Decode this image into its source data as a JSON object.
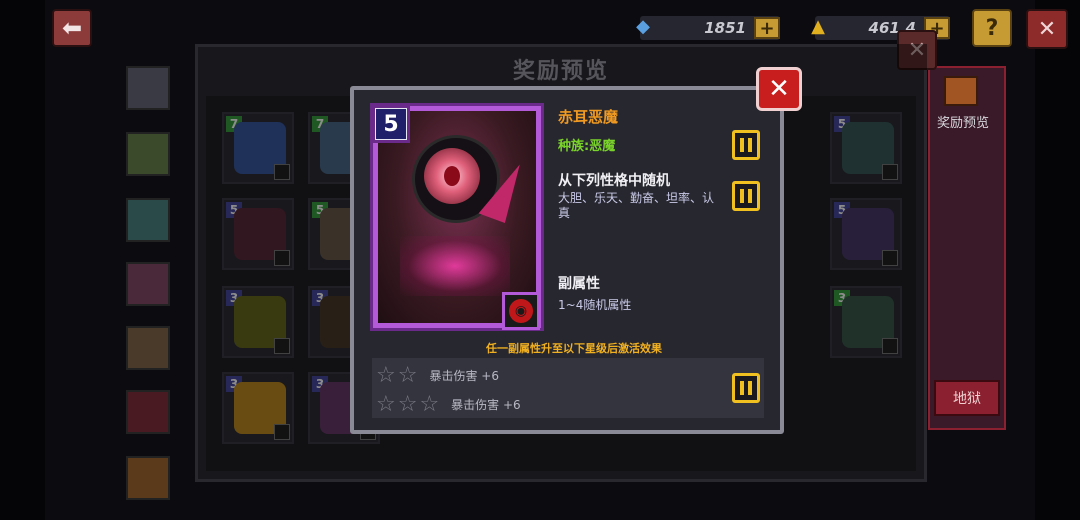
{
  "topbar": {
    "back_icon": "back-arrow-icon",
    "gem_count": "1851",
    "gold_count": "461.4",
    "plus_label": "+",
    "help_label": "?",
    "close_label": "✕"
  },
  "reward_panel": {
    "title": "奖励预览",
    "close_label": "✕"
  },
  "side_panel": {
    "reward_preview_label": "奖励预览",
    "hell_label": "地狱"
  },
  "mini_cards": [
    {
      "stars": "7",
      "color": "#3a5aa0"
    },
    {
      "stars": "7",
      "color": "#4a6a8a"
    },
    {
      "stars": "5",
      "color": "#5a2a3a"
    },
    {
      "stars": "5",
      "color": "#6a5a4a"
    },
    {
      "stars": "3",
      "color": "#6a6a20"
    },
    {
      "stars": "3",
      "color": "#4a3a2a"
    },
    {
      "stars": "3",
      "color": "#c08a20"
    },
    {
      "stars": "3",
      "color": "#6a3a6a"
    },
    {
      "stars": "5",
      "color": "#3a5a5a"
    },
    {
      "stars": "5",
      "color": "#4a3a6a"
    },
    {
      "stars": "3",
      "color": "#3a5a4a"
    }
  ],
  "card_detail": {
    "star_level": "5",
    "name": "赤耳恶魔",
    "race": "种族:恶魔",
    "personality_title": "从下列性格中随机",
    "personality_values": "大胆、乐天、勤奋、坦率、认真",
    "sub_attr_title": "副属性",
    "sub_attr_value": "1~4随机属性",
    "activation_note": "任一副属性升至以下星级后激活效果",
    "bonuses": [
      {
        "stars": "☆☆",
        "text": "暴击伤害 +6"
      },
      {
        "stars": "☆☆☆",
        "text": "暴击伤害 +6"
      }
    ],
    "close_label": "✕",
    "class_icon": "demon-class-icon"
  },
  "colors": {
    "name": "#f09a22",
    "race": "#7ad32a",
    "note": "#f0b020",
    "popup_close": "#c81e1e",
    "card_rarity": "#b25ad8"
  }
}
